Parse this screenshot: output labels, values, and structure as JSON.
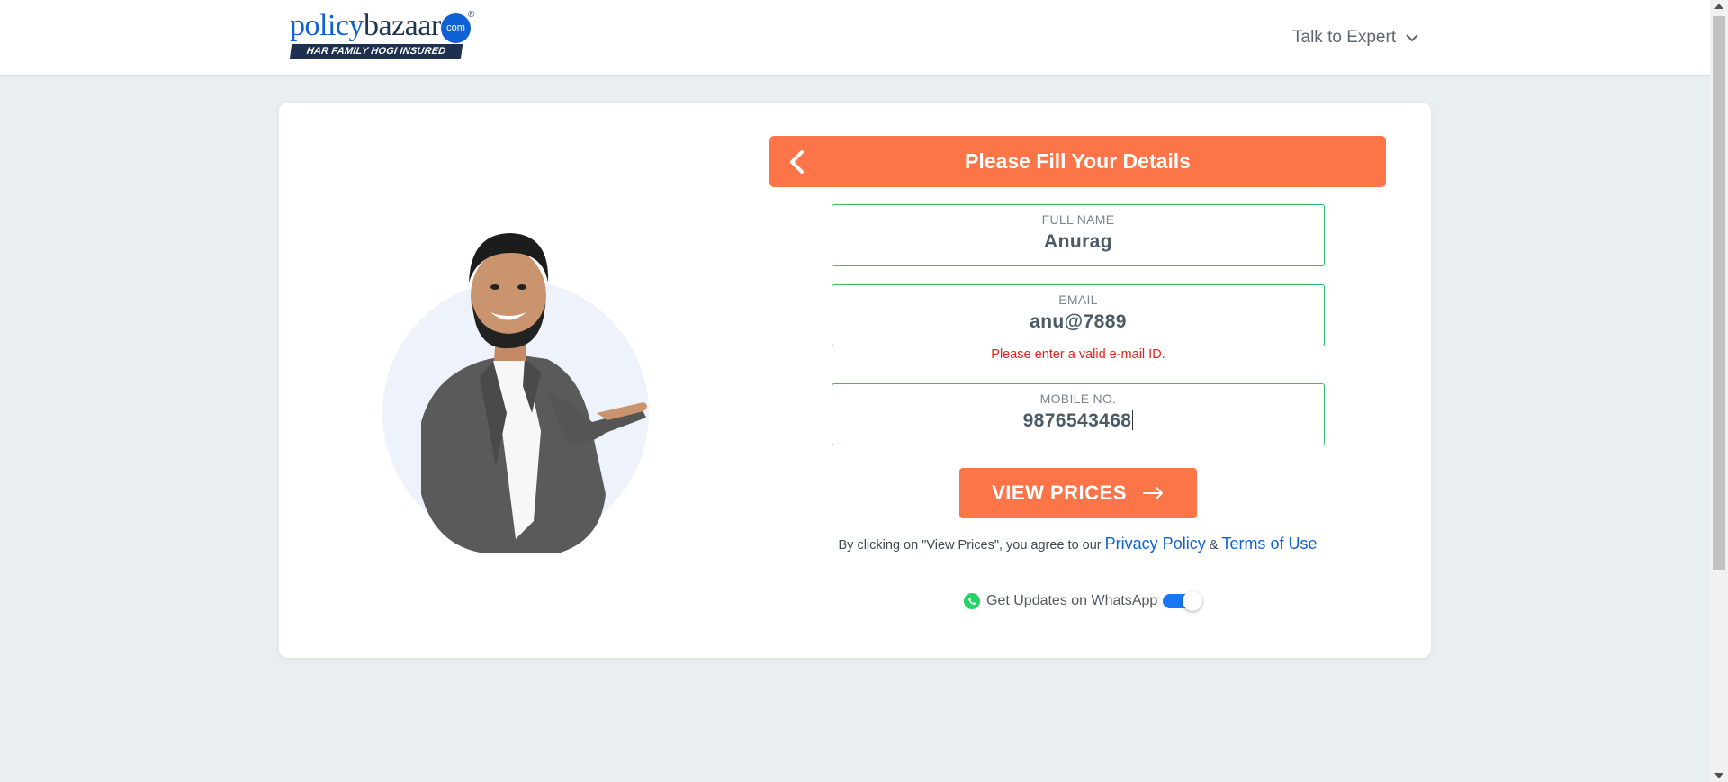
{
  "header": {
    "logo": {
      "part1": "policy",
      "part2": "bazaar",
      "com": "com",
      "reg": "®",
      "tagline": "HAR FAMILY HOGI INSURED"
    },
    "talk_to_expert": "Talk to Expert"
  },
  "form": {
    "title": "Please Fill Your Details",
    "fields": [
      {
        "label": "FULL NAME",
        "value": "Anurag"
      },
      {
        "label": "EMAIL",
        "value": "anu@7889"
      },
      {
        "label": "MOBILE NO.",
        "value": "9876543468"
      }
    ],
    "email_error": "Please enter a valid e-mail ID.",
    "submit_label": "VIEW PRICES",
    "terms_prefix": "By clicking on \"View Prices\", you agree to our",
    "privacy_policy": "Privacy Policy",
    "terms_amp": "&",
    "terms_of_use": "Terms of Use",
    "whatsapp_label": "Get Updates on WhatsApp",
    "whatsapp_enabled": true
  },
  "colors": {
    "accent": "#fb7549",
    "brand_blue": "#0f62d6",
    "field_border": "#2fc06b",
    "error": "#e8201d",
    "background": "#e9eef1"
  }
}
